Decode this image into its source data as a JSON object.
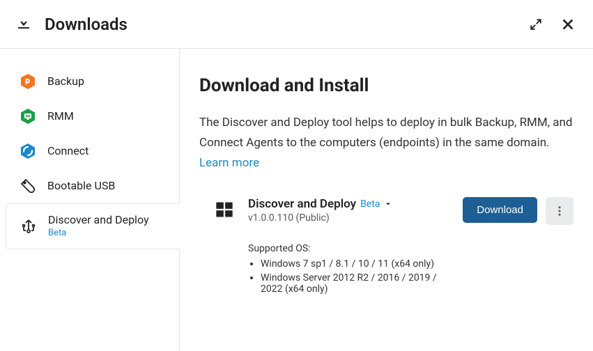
{
  "header": {
    "title": "Downloads"
  },
  "sidebar": {
    "items": [
      {
        "label": "Backup"
      },
      {
        "label": "RMM"
      },
      {
        "label": "Connect"
      },
      {
        "label": "Bootable USB"
      },
      {
        "label": "Discover and Deploy",
        "badge": "Beta"
      }
    ]
  },
  "main": {
    "heading": "Download and Install",
    "descriptionPrefix": "The Discover and Deploy tool helps to deploy in bulk Backup, RMM, and Connect Agents to the computers (endpoints) in the same domain. ",
    "learnMoreLabel": "Learn more"
  },
  "product": {
    "name": "Discover and Deploy",
    "betaTag": "Beta",
    "version": "v1.0.0.110 (Public)",
    "downloadLabel": "Download",
    "supported": {
      "label": "Supported OS:",
      "items": [
        "Windows 7 sp1 / 8.1 / 10 / 11 (x64 only)",
        "Windows Server 2012 R2 / 2016 / 2019 / 2022 (x64 only)"
      ]
    }
  },
  "colors": {
    "accent": "#1e88c8",
    "primaryBtn": "#1d5e95"
  }
}
